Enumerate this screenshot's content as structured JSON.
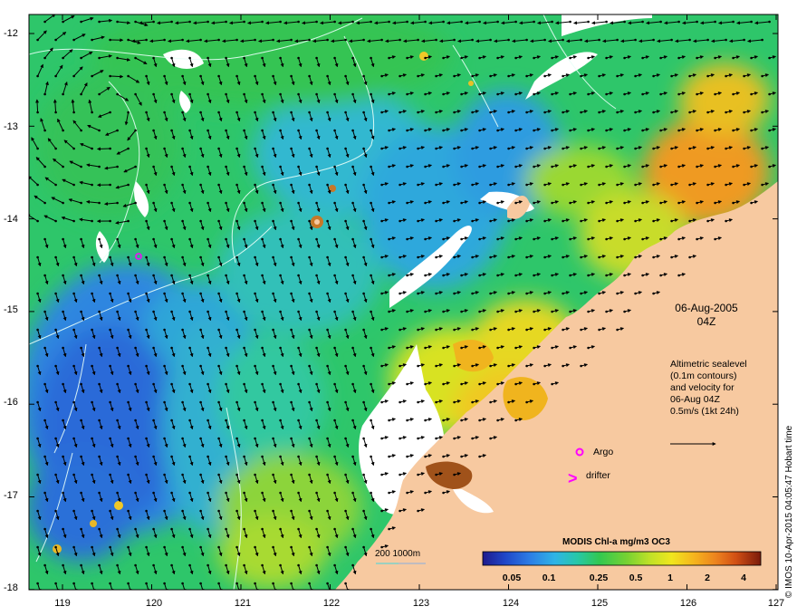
{
  "map": {
    "date": "06-Aug-2005",
    "time": "04Z",
    "altimetry_note": [
      "Altimetric sealevel",
      "(0.1m contours)",
      "and velocity for",
      "06-Aug 04Z",
      "0.5m/s (1kt 24h)"
    ],
    "credit": "© IMOS 10-Apr-2015 04:05:47 Hobart time",
    "argo_label": "Argo",
    "drifter_label": "drifter",
    "drifter_symbol": ">",
    "bathy_label": "200  1000m",
    "lon_ticks": [
      "119",
      "120",
      "121",
      "122",
      "123",
      "124",
      "125",
      "126",
      "127"
    ],
    "lat_ticks": [
      "-12",
      "-13",
      "-14",
      "-15",
      "-16",
      "-17",
      "-18"
    ],
    "colorbar": {
      "title": "MODIS Chl-a mg/m3 OC3",
      "ticks": [
        "0.05",
        "0.1",
        "0.25",
        "0.5",
        "1",
        "2",
        "4"
      ],
      "colors": [
        "#1e1a8c",
        "#1f46c8",
        "#2c7ee6",
        "#2fb4e6",
        "#27c8a8",
        "#32c850",
        "#78d232",
        "#bee128",
        "#f0e61e",
        "#f5b41e",
        "#ec821e",
        "#d25014",
        "#a52d0f",
        "#7a1a0a"
      ]
    },
    "colors": {
      "land": "#f7c9a0",
      "cloud": "#ffffff",
      "arrow": "#000000",
      "contour": "#e8fff8",
      "bathy_line": "#40d8e0",
      "argo": "#ff00ff",
      "drifter": "#ff00ff"
    }
  }
}
